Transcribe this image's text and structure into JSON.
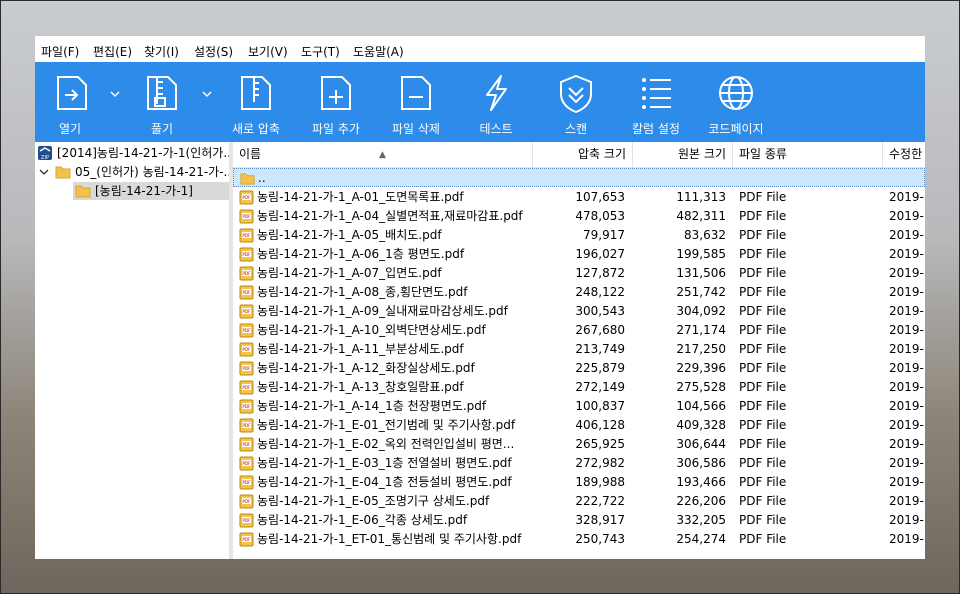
{
  "menu": [
    "파일(F)",
    "편집(E)",
    "찾기(I)",
    "설정(S)",
    "보기(V)",
    "도구(T)",
    "도움말(A)"
  ],
  "toolbar": {
    "open": "열기",
    "extract": "풀기",
    "new_archive": "새로 압축",
    "add_file": "파일 추가",
    "delete_file": "파일 삭제",
    "test": "테스트",
    "scan": "스캔",
    "column_settings": "칼럼 설정",
    "codepage": "코드페이지"
  },
  "tree": {
    "root": "[2014]농림-14-21-가-1(인허가...",
    "child": "05_(인허가) 농림-14-21-가-...",
    "grandchild": "[농림-14-21-가-1]"
  },
  "columns": {
    "name": "이름",
    "compressed": "압축 크기",
    "original": "원본 크기",
    "type": "파일 종류",
    "modified": "수정한"
  },
  "parent_row": "..",
  "files": [
    {
      "name": "농림-14-21-가-1_A-01_도면목록표.pdf",
      "compressed": "107,653",
      "original": "111,313",
      "type": "PDF File",
      "date": "2019-"
    },
    {
      "name": "농림-14-21-가-1_A-04_실별면적표,재료마감표.pdf",
      "compressed": "478,053",
      "original": "482,311",
      "type": "PDF File",
      "date": "2019-"
    },
    {
      "name": "농림-14-21-가-1_A-05_배치도.pdf",
      "compressed": "79,917",
      "original": "83,632",
      "type": "PDF File",
      "date": "2019-"
    },
    {
      "name": "농림-14-21-가-1_A-06_1층 평면도.pdf",
      "compressed": "196,027",
      "original": "199,585",
      "type": "PDF File",
      "date": "2019-"
    },
    {
      "name": "농림-14-21-가-1_A-07_입면도.pdf",
      "compressed": "127,872",
      "original": "131,506",
      "type": "PDF File",
      "date": "2019-"
    },
    {
      "name": "농림-14-21-가-1_A-08_종,횡단면도.pdf",
      "compressed": "248,122",
      "original": "251,742",
      "type": "PDF File",
      "date": "2019-"
    },
    {
      "name": "농림-14-21-가-1_A-09_실내재료마감상세도.pdf",
      "compressed": "300,543",
      "original": "304,092",
      "type": "PDF File",
      "date": "2019-"
    },
    {
      "name": "농림-14-21-가-1_A-10_외벽단면상세도.pdf",
      "compressed": "267,680",
      "original": "271,174",
      "type": "PDF File",
      "date": "2019-"
    },
    {
      "name": "농림-14-21-가-1_A-11_부분상세도.pdf",
      "compressed": "213,749",
      "original": "217,250",
      "type": "PDF File",
      "date": "2019-"
    },
    {
      "name": "농림-14-21-가-1_A-12_화장실상세도.pdf",
      "compressed": "225,879",
      "original": "229,396",
      "type": "PDF File",
      "date": "2019-"
    },
    {
      "name": "농림-14-21-가-1_A-13_창호일람표.pdf",
      "compressed": "272,149",
      "original": "275,528",
      "type": "PDF File",
      "date": "2019-"
    },
    {
      "name": "농림-14-21-가-1_A-14_1층 천장평면도.pdf",
      "compressed": "100,837",
      "original": "104,566",
      "type": "PDF File",
      "date": "2019-"
    },
    {
      "name": "농림-14-21-가-1_E-01_전기범례 및 주기사항.pdf",
      "compressed": "406,128",
      "original": "409,328",
      "type": "PDF File",
      "date": "2019-"
    },
    {
      "name": "농림-14-21-가-1_E-02_옥외 전력인입설비 평면...",
      "compressed": "265,925",
      "original": "306,644",
      "type": "PDF File",
      "date": "2019-"
    },
    {
      "name": "농림-14-21-가-1_E-03_1층 전열설비 평면도.pdf",
      "compressed": "272,982",
      "original": "306,586",
      "type": "PDF File",
      "date": "2019-"
    },
    {
      "name": "농림-14-21-가-1_E-04_1층 전등설비 평면도.pdf",
      "compressed": "189,988",
      "original": "193,466",
      "type": "PDF File",
      "date": "2019-"
    },
    {
      "name": "농림-14-21-가-1_E-05_조명기구 상세도.pdf",
      "compressed": "222,722",
      "original": "226,206",
      "type": "PDF File",
      "date": "2019-"
    },
    {
      "name": "농림-14-21-가-1_E-06_각종 상세도.pdf",
      "compressed": "328,917",
      "original": "332,205",
      "type": "PDF File",
      "date": "2019-"
    },
    {
      "name": "농림-14-21-가-1_ET-01_통신범례 및 주기사항.pdf",
      "compressed": "250,743",
      "original": "254,274",
      "type": "PDF File",
      "date": "2019-"
    }
  ]
}
